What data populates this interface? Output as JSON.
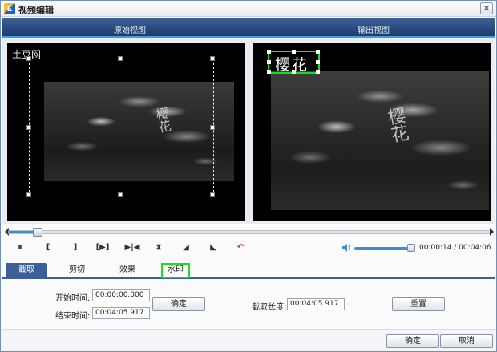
{
  "window": {
    "title": "视频编辑",
    "app_icon": "app-logo-icon",
    "close_glyph": "✕"
  },
  "header": {
    "original_view_label": "原始视图",
    "output_view_label": "输出视图"
  },
  "preview": {
    "source_watermark_text": "土豆网",
    "video_caption_text": "樱花",
    "output_watermark_text": "樱花"
  },
  "playback": {
    "progress_fraction": 0.06,
    "volume_fraction": 0.9,
    "time_display": "00:00:14 / 00:04:06",
    "controls": {
      "pause": "⏸",
      "mark_in": "[",
      "mark_out": "]",
      "clip_play": "[▶]",
      "go_start": "▶|◀",
      "mid_marker": "⧗",
      "flip_left": "◢",
      "flip_right": "◣",
      "undo": "↶"
    }
  },
  "tabs": {
    "items": [
      "截取",
      "剪切",
      "效果",
      "水印"
    ],
    "active_index": 0,
    "highlight_index": 3
  },
  "trim": {
    "start_label": "开始时间:",
    "start_value": "00:00:00.000",
    "end_label": "结束时间:",
    "end_value": "00:04:05.917",
    "confirm_label": "确定",
    "length_label": "截取长度:",
    "length_value": "00:04:05.917",
    "reset_label": "重置"
  },
  "footer": {
    "ok_label": "确定",
    "cancel_label": "取消"
  },
  "colors": {
    "header_blue": "#1e3b6b",
    "accent_blue": "#3a8fd6",
    "highlight_green": "#19e01e"
  }
}
